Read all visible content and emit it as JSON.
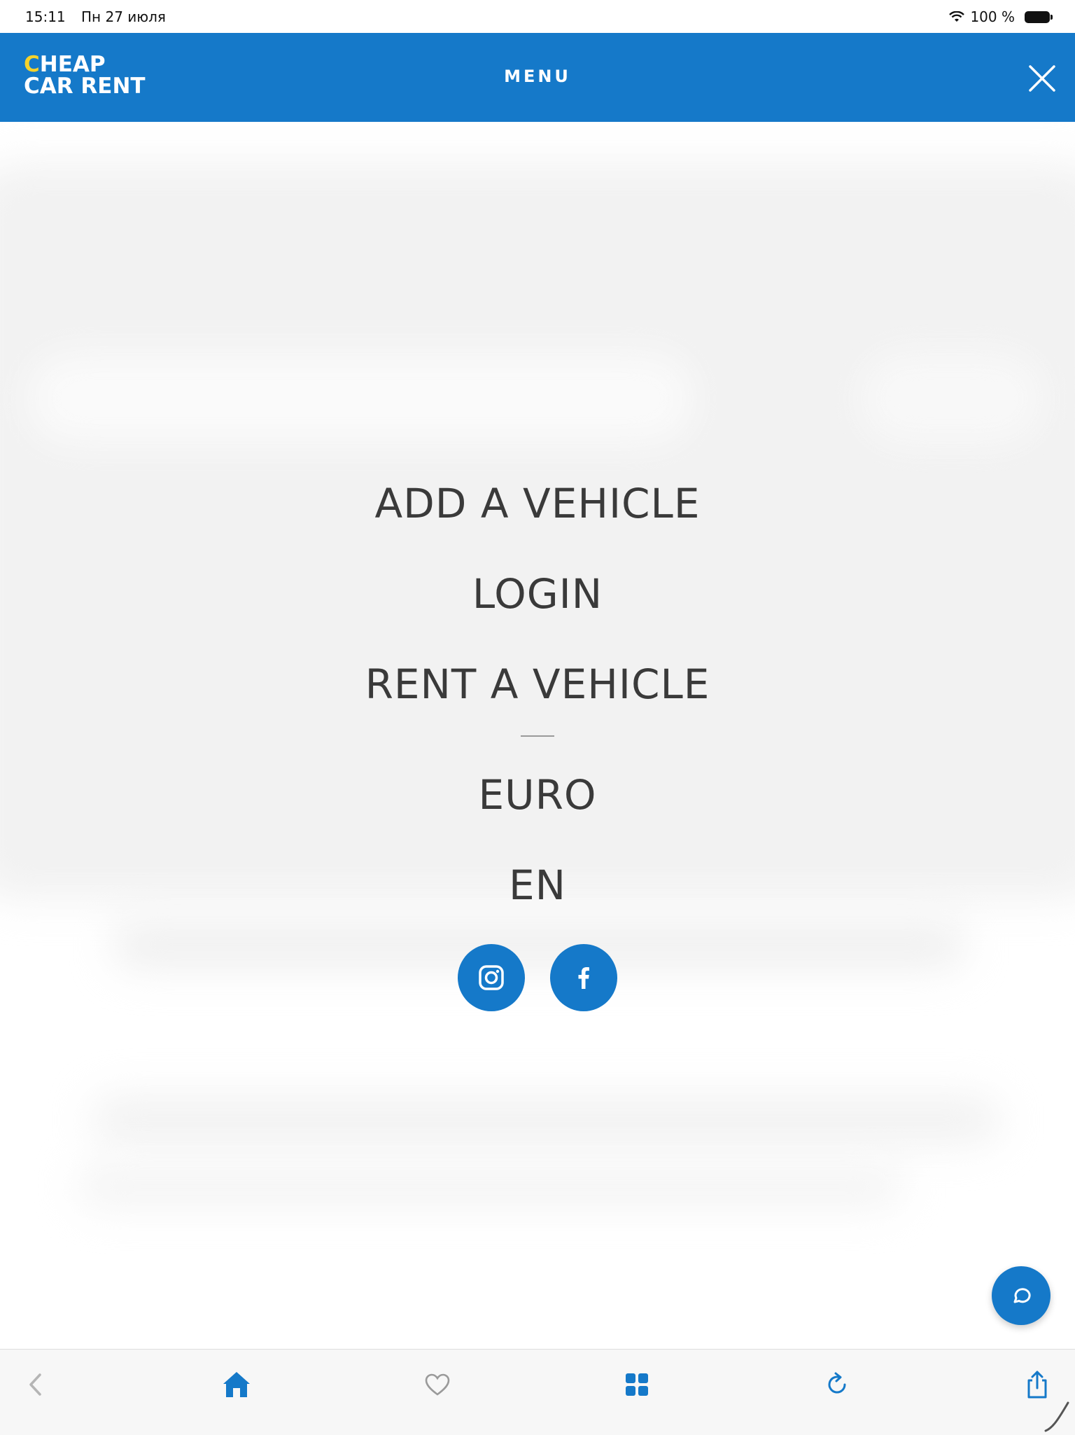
{
  "status_bar": {
    "time": "15:11",
    "date": "Пн 27 июля",
    "battery": "100 %",
    "icons": [
      "wifi-icon",
      "battery-icon"
    ]
  },
  "header": {
    "logo_line1_first": "C",
    "logo_line1_rest": "HEAP",
    "logo_line2": "CAR RENT",
    "title": "MENU",
    "close_icon": "close-icon"
  },
  "menu": {
    "items": [
      "ADD A VEHICLE",
      "LOGIN",
      "RENT A VEHICLE"
    ],
    "currency": "EURO",
    "language": "EN"
  },
  "social": {
    "icons": [
      "instagram-icon",
      "facebook-icon"
    ]
  },
  "chat": {
    "icon": "chat-icon"
  },
  "toolbar": {
    "icons": [
      "back-icon",
      "home-icon",
      "heart-icon",
      "grid-icon",
      "refresh-icon",
      "share-icon"
    ]
  },
  "colors": {
    "brand_blue": "#1579c9",
    "logo_yellow": "#f6d22a",
    "menu_text": "#3a3a3a"
  }
}
